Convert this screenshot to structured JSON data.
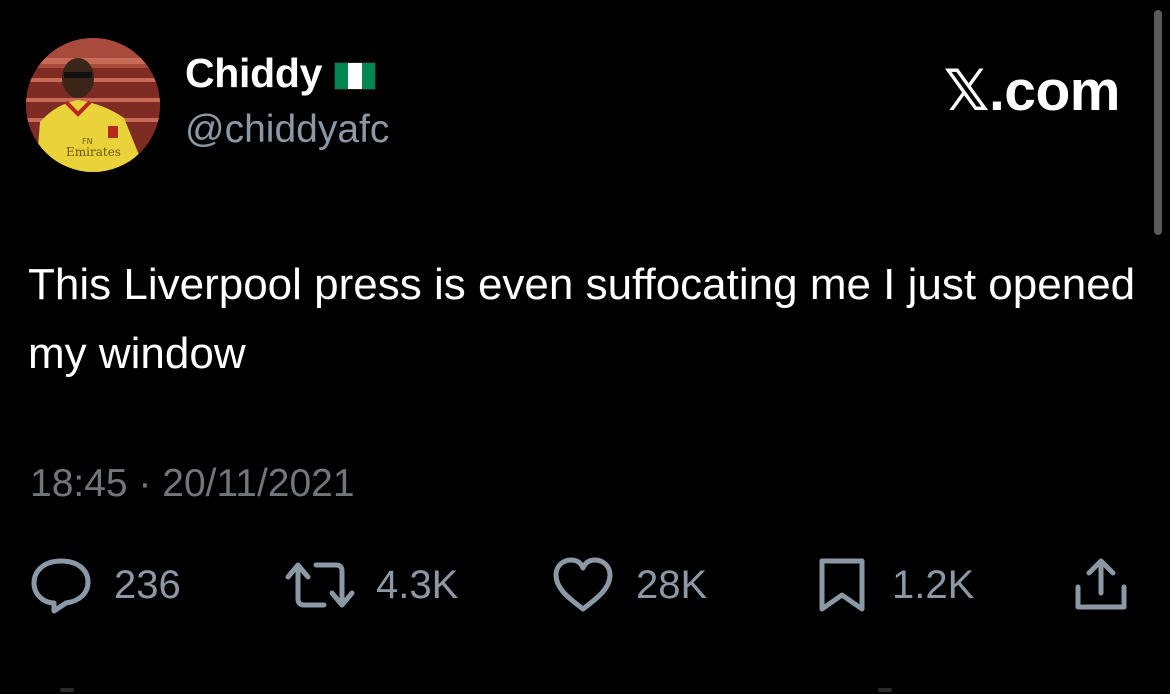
{
  "tweet": {
    "display_name": "Chiddy",
    "handle": "@chiddyafc",
    "brand": "𝕏.com",
    "text": "This Liverpool press is even suffocating me I just opened my window",
    "timestamp": "18:45 · 20/11/2021",
    "verified_flag": "nigeria-flag-icon"
  },
  "actions": {
    "replies": "236",
    "retweets": "4.3K",
    "likes": "28K",
    "bookmarks": "1.2K"
  },
  "icons": {
    "reply": "reply-bubble-icon",
    "retweet": "retweet-icon",
    "like": "heart-icon",
    "bookmark": "bookmark-icon",
    "share": "share-icon"
  },
  "colors": {
    "background": "#000000",
    "text_primary": "#ffffff",
    "text_secondary": "#8b98a5",
    "flag_green": "#008751",
    "flag_white": "#ffffff"
  }
}
